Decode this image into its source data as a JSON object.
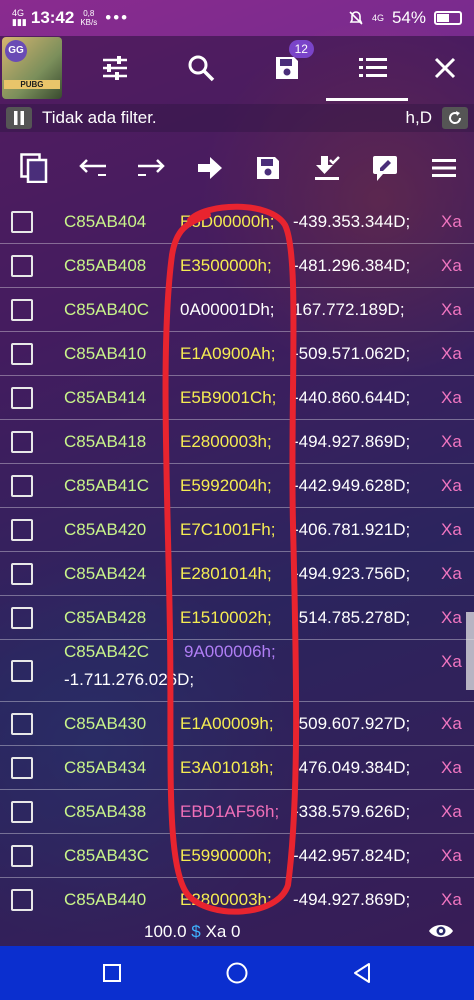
{
  "status_bar": {
    "network": "4G",
    "time": "13:42",
    "speed_value": "0,8",
    "speed_unit": "KB/s",
    "dots": "•••",
    "network_right": "4G",
    "battery": "54%",
    "battery_level": 0.54
  },
  "toolbar": {
    "app_badge": "GG",
    "app_game_label": "PUBG",
    "icons": [
      "sliders-icon",
      "search-icon",
      "save-icon",
      "list-icon",
      "close-icon"
    ],
    "saved_count": "12"
  },
  "filter": {
    "text": "Tidak ada filter.",
    "mode": "h,D"
  },
  "actions": [
    "copy-icon",
    "arrow-left-icon",
    "arrow-right-icon",
    "go-icon",
    "save-icon",
    "download-check-icon",
    "edit-icon",
    "menu-icon"
  ],
  "rows": [
    {
      "address": "C85AB404",
      "hex": "E5D00000h;",
      "hex_color": "yellow",
      "decimal": "-439.353.344D;",
      "type": "Xa"
    },
    {
      "address": "C85AB408",
      "hex": "E3500000h;",
      "hex_color": "yellow",
      "decimal": "-481.296.384D;",
      "type": "Xa"
    },
    {
      "address": "C85AB40C",
      "hex": "0A00001Dh;",
      "hex_color": "white",
      "decimal": "167.772.189D;",
      "type": "Xa"
    },
    {
      "address": "C85AB410",
      "hex": "E1A0900Ah;",
      "hex_color": "yellow",
      "decimal": "-509.571.062D;",
      "type": "Xa"
    },
    {
      "address": "C85AB414",
      "hex": "E5B9001Ch;",
      "hex_color": "yellow",
      "decimal": "-440.860.644D;",
      "type": "Xa"
    },
    {
      "address": "C85AB418",
      "hex": "E2800003h;",
      "hex_color": "yellow",
      "decimal": "-494.927.869D;",
      "type": "Xa"
    },
    {
      "address": "C85AB41C",
      "hex": "E5992004h;",
      "hex_color": "yellow",
      "decimal": "-442.949.628D;",
      "type": "Xa"
    },
    {
      "address": "C85AB420",
      "hex": "E7C1001Fh;",
      "hex_color": "yellow",
      "decimal": "-406.781.921D;",
      "type": "Xa"
    },
    {
      "address": "C85AB424",
      "hex": "E2801014h;",
      "hex_color": "yellow",
      "decimal": "-494.923.756D;",
      "type": "Xa"
    },
    {
      "address": "C85AB428",
      "hex": "E1510002h;",
      "hex_color": "yellow",
      "decimal": "-514.785.278D;",
      "type": "Xa"
    },
    {
      "address": "C85AB42C",
      "hex": "9A000006h;",
      "hex_color": "purple",
      "decimal": "-1.711.276.026D;",
      "type": "Xa",
      "tall": true
    },
    {
      "address": "C85AB430",
      "hex": "E1A00009h;",
      "hex_color": "yellow",
      "decimal": "-509.607.927D;",
      "type": "Xa"
    },
    {
      "address": "C85AB434",
      "hex": "E3A01018h;",
      "hex_color": "yellow",
      "decimal": "-476.049.384D;",
      "type": "Xa"
    },
    {
      "address": "C85AB438",
      "hex": "EBD1AF56h;",
      "hex_color": "pink",
      "decimal": "-338.579.626D;",
      "type": "Xa"
    },
    {
      "address": "C85AB43C",
      "hex": "E5990000h;",
      "hex_color": "yellow",
      "decimal": "-442.957.824D;",
      "type": "Xa"
    },
    {
      "address": "C85AB440",
      "hex": "E2800003h;",
      "hex_color": "yellow",
      "decimal": "-494.927.869D;",
      "type": "Xa"
    }
  ],
  "bottom": {
    "value": "100.0",
    "symbol": "$",
    "type_label": "Xa 0"
  },
  "navbar": [
    "recents-icon",
    "home-icon",
    "back-icon"
  ],
  "colors": {
    "address": "#c9f58a",
    "hex_yellow": "#f5ec52",
    "hex_pink": "#f06fb8",
    "hex_purple": "#b07ef5",
    "type": "#f075c0",
    "nav_bg": "#0b2fcf",
    "annotation": "#e8242f"
  }
}
